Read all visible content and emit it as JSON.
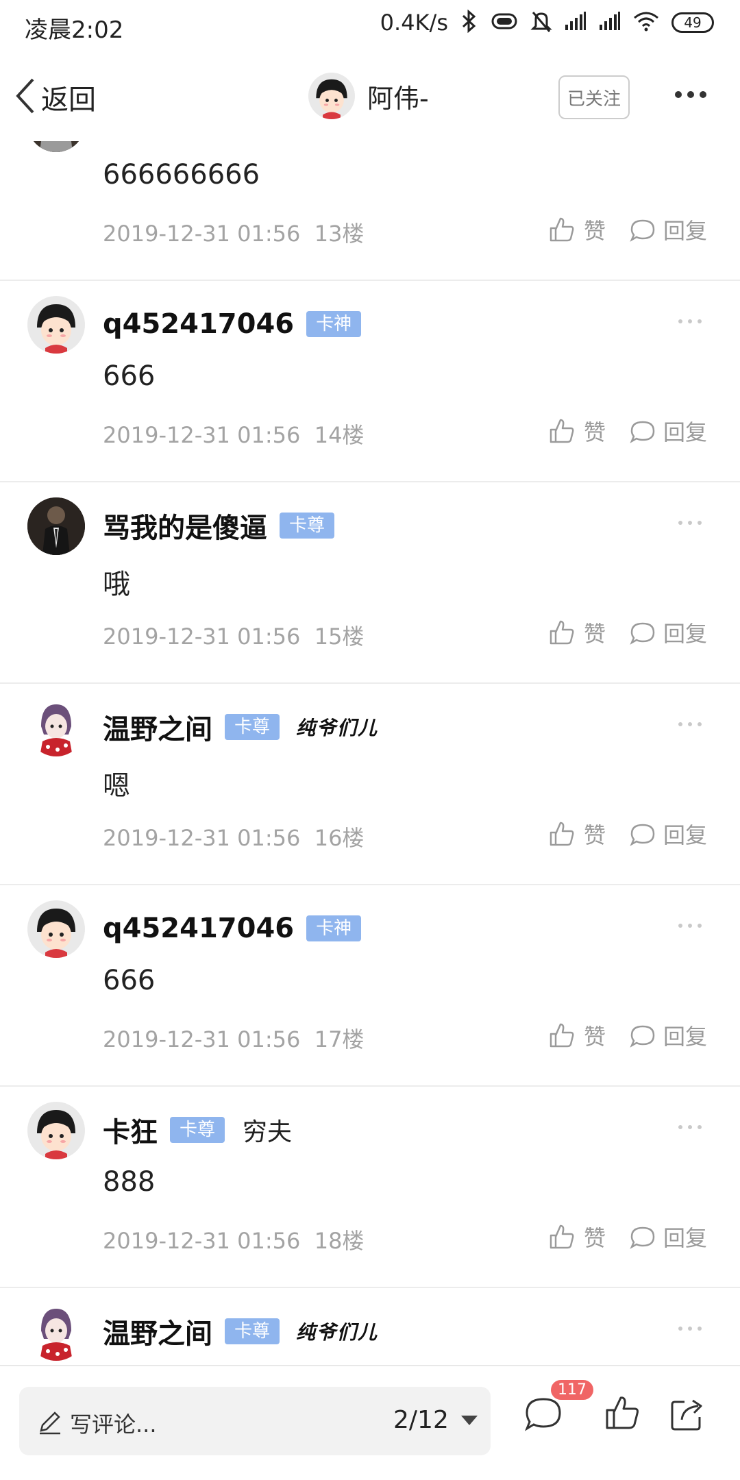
{
  "status_bar": {
    "time": "凌晨2:02",
    "net_speed": "0.4K/s",
    "battery": "49",
    "icons": [
      "bluetooth-icon",
      "vibrate-icon",
      "mute-icon",
      "signal-icon",
      "signal-icon",
      "wifi-icon",
      "battery-icon"
    ]
  },
  "header": {
    "back_label": "返回",
    "username": "阿伟-",
    "follow_label": "已关注",
    "more_icon": "more-dots-icon"
  },
  "comments": [
    {
      "name": "",
      "badge": "",
      "tag": "",
      "signature": "",
      "text": "666666666",
      "date": "2019-12-31 01:56",
      "floor": "13楼",
      "like": "赞",
      "reply": "回复",
      "avatar": "dark-avatar"
    },
    {
      "name": "q452417046",
      "badge": "卡神",
      "tag": "",
      "signature": "",
      "text": "666",
      "date": "2019-12-31 01:56",
      "floor": "14楼",
      "like": "赞",
      "reply": "回复",
      "avatar": "cartoon-avatar"
    },
    {
      "name": "骂我的是傻逼",
      "badge": "卡尊",
      "tag": "",
      "signature": "",
      "text": "哦",
      "date": "2019-12-31 01:56",
      "floor": "15楼",
      "like": "赞",
      "reply": "回复",
      "avatar": "dark-avatar"
    },
    {
      "name": "温野之间",
      "badge": "卡尊",
      "tag": "",
      "signature": "纯爷们儿",
      "text": "嗯",
      "date": "2019-12-31 01:56",
      "floor": "16楼",
      "like": "赞",
      "reply": "回复",
      "avatar": "anime-avatar"
    },
    {
      "name": "q452417046",
      "badge": "卡神",
      "tag": "",
      "signature": "",
      "text": "666",
      "date": "2019-12-31 01:56",
      "floor": "17楼",
      "like": "赞",
      "reply": "回复",
      "avatar": "cartoon-avatar"
    },
    {
      "name": "卡狂",
      "badge": "卡尊",
      "tag": "穷夫",
      "signature": "",
      "text": "888",
      "date": "2019-12-31 01:56",
      "floor": "18楼",
      "like": "赞",
      "reply": "回复",
      "avatar": "cartoon-avatar"
    },
    {
      "name": "温野之间",
      "badge": "卡尊",
      "tag": "",
      "signature": "纯爷们儿",
      "text": "",
      "date": "",
      "floor": "",
      "like": "",
      "reply": "",
      "avatar": "anime-avatar"
    }
  ],
  "bottom_bar": {
    "input_placeholder": "写评论...",
    "page_indicator": "2/12",
    "comment_count": "117"
  },
  "colors": {
    "badge_blue": "#8fb5ee",
    "count_red": "#f06565",
    "meta_gray": "#a3a3a3",
    "divider": "#ececec"
  }
}
